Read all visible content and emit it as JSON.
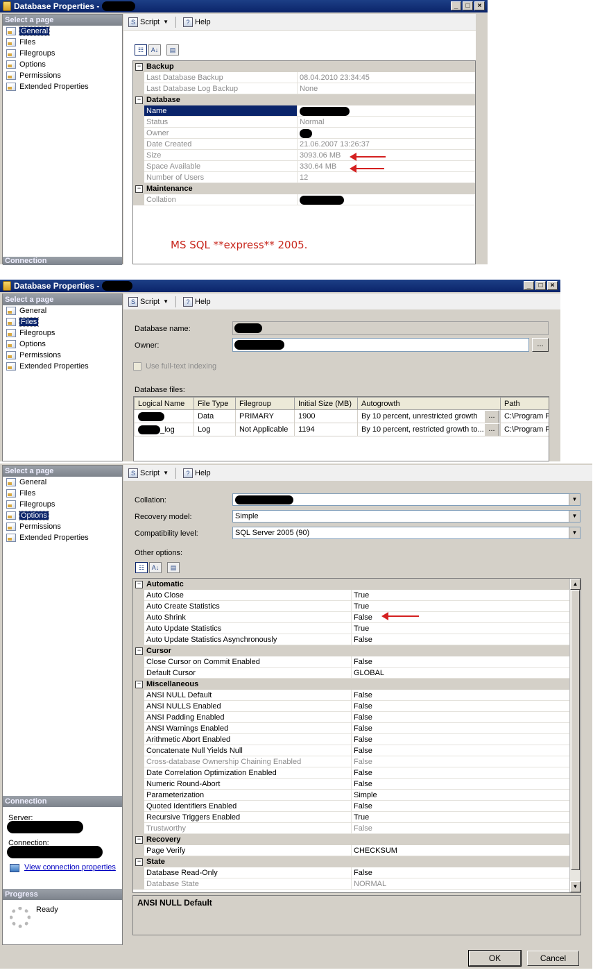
{
  "window": {
    "title": "Database Properties -"
  },
  "nav": {
    "select_header": "Select a page",
    "items": [
      "General",
      "Files",
      "Filegroups",
      "Options",
      "Permissions",
      "Extended Properties"
    ],
    "connection_header": "Connection",
    "progress_header": "Progress"
  },
  "toolbar": {
    "script_label": "Script",
    "help_label": "Help"
  },
  "general": {
    "categories": {
      "backup": "Backup",
      "database": "Database",
      "maintenance": "Maintenance"
    },
    "rows": {
      "last_backup": {
        "label": "Last Database Backup",
        "value": "08.04.2010 23:34:45"
      },
      "last_log_backup": {
        "label": "Last Database Log Backup",
        "value": "None"
      },
      "name": {
        "label": "Name",
        "value": ""
      },
      "status": {
        "label": "Status",
        "value": "Normal"
      },
      "owner": {
        "label": "Owner",
        "value": ""
      },
      "date_created": {
        "label": "Date Created",
        "value": "21.06.2007 13:26:37"
      },
      "size": {
        "label": "Size",
        "value": "3093.06 MB"
      },
      "space_available": {
        "label": "Space Available",
        "value": "330.64 MB"
      },
      "number_of_users": {
        "label": "Number of Users",
        "value": "12"
      },
      "collation": {
        "label": "Collation",
        "value": ""
      }
    },
    "annotation": "MS SQL **express** 2005.",
    "connection_label": "Connection"
  },
  "files": {
    "database_name_label": "Database name:",
    "owner_label": "Owner:",
    "fulltext_label": "Use full-text indexing",
    "database_files_label": "Database files:",
    "columns": [
      "Logical Name",
      "File Type",
      "Filegroup",
      "Initial Size (MB)",
      "Autogrowth",
      "Path"
    ],
    "rows": [
      {
        "logical_name": "",
        "file_type": "Data",
        "filegroup": "PRIMARY",
        "initial_size": "1900",
        "autogrowth": "By 10 percent, unrestricted growth",
        "path": "C:\\Program F"
      },
      {
        "logical_name": "_log",
        "file_type": "Log",
        "filegroup": "Not Applicable",
        "initial_size": "1194",
        "autogrowth": "By 10 percent, restricted growth to...",
        "path": "C:\\Program F"
      }
    ]
  },
  "options": {
    "collation_label": "Collation:",
    "recovery_model_label": "Recovery model:",
    "recovery_model_value": "Simple",
    "compat_label": "Compatibility level:",
    "compat_value": "SQL Server 2005 (90)",
    "other_options_label": "Other options:",
    "categories": {
      "automatic": "Automatic",
      "cursor": "Cursor",
      "misc": "Miscellaneous",
      "recovery": "Recovery",
      "state": "State"
    },
    "automatic": [
      {
        "label": "Auto Close",
        "value": "True"
      },
      {
        "label": "Auto Create Statistics",
        "value": "True"
      },
      {
        "label": "Auto Shrink",
        "value": "False"
      },
      {
        "label": "Auto Update Statistics",
        "value": "True"
      },
      {
        "label": "Auto Update Statistics Asynchronously",
        "value": "False"
      }
    ],
    "cursor": [
      {
        "label": "Close Cursor on Commit Enabled",
        "value": "False"
      },
      {
        "label": "Default Cursor",
        "value": "GLOBAL"
      }
    ],
    "misc": [
      {
        "label": "ANSI NULL Default",
        "value": "False"
      },
      {
        "label": "ANSI NULLS Enabled",
        "value": "False"
      },
      {
        "label": "ANSI Padding Enabled",
        "value": "False"
      },
      {
        "label": "ANSI Warnings Enabled",
        "value": "False"
      },
      {
        "label": "Arithmetic Abort Enabled",
        "value": "False"
      },
      {
        "label": "Concatenate Null Yields Null",
        "value": "False"
      },
      {
        "label": "Cross-database Ownership Chaining Enabled",
        "value": "False"
      },
      {
        "label": "Date Correlation Optimization Enabled",
        "value": "False"
      },
      {
        "label": "Numeric Round-Abort",
        "value": "False"
      },
      {
        "label": "Parameterization",
        "value": "Simple"
      },
      {
        "label": "Quoted Identifiers Enabled",
        "value": "False"
      },
      {
        "label": "Recursive Triggers Enabled",
        "value": "True"
      },
      {
        "label": "Trustworthy",
        "value": "False"
      }
    ],
    "recovery": [
      {
        "label": "Page Verify",
        "value": "CHECKSUM"
      }
    ],
    "state": [
      {
        "label": "Database Read-Only",
        "value": "False"
      },
      {
        "label": "Database State",
        "value": "NORMAL"
      }
    ],
    "description_title": "ANSI NULL Default",
    "server_label": "Server:",
    "connection_label": "Connection:",
    "view_conn_props": "View connection properties",
    "progress_status": "Ready",
    "ok_label": "OK",
    "cancel_label": "Cancel"
  }
}
